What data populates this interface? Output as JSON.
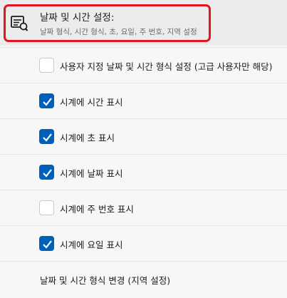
{
  "header": {
    "icon": "calendar-clock-icon",
    "title": "날짜 및 시간 설정:",
    "subtitle": "날짜 형식, 시간 형식, 초, 요일, 주 번호, 지역 설정"
  },
  "options": [
    {
      "label": "사용자 지정 날짜 및 시간 형식 설정 (고급 사용자만 해당)",
      "checked": false
    },
    {
      "label": "시계에 시간 표시",
      "checked": true
    },
    {
      "label": "시계에 초 표시",
      "checked": true
    },
    {
      "label": "시계에 날짜 표시",
      "checked": true
    },
    {
      "label": "시계에 주 번호 표시",
      "checked": false
    },
    {
      "label": "시계에 요일 표시",
      "checked": true
    }
  ],
  "footer_link": {
    "label": "날짜 및 시간 형식 변경 (지역 설정)"
  },
  "colors": {
    "accent": "#005fb8",
    "highlight": "#e4141c"
  }
}
